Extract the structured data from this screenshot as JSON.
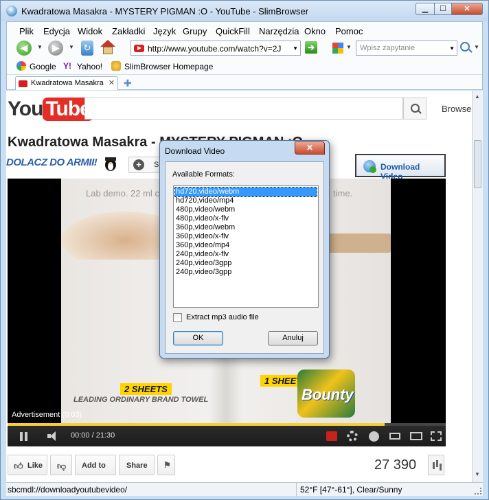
{
  "window": {
    "title": "Kwadratowa Masakra - MYSTERY PIGMAN :O - YouTube - SlimBrowser",
    "min": "▁",
    "max": "☐",
    "close": "✕"
  },
  "menu": [
    "Plik",
    "Edycja",
    "Widok",
    "Zakładki",
    "Język",
    "Grupy",
    "QuickFill",
    "Narzędzia",
    "Okno",
    "Pomoc"
  ],
  "nav": {
    "url": "http://www.youtube.com/watch?v=2J",
    "search_placeholder": "Wpisz zapytanie",
    "back_icon": "back-arrow-icon",
    "forward_icon": "forward-arrow-icon",
    "go_label": "➔"
  },
  "bookmarks": [
    {
      "label": "Google",
      "icon": "google-icon"
    },
    {
      "label": "Yahoo!",
      "icon": "yahoo-icon"
    },
    {
      "label": "SlimBrowser Homepage",
      "icon": "slimbrowser-icon"
    }
  ],
  "tabs": [
    {
      "label": "Kwadratowa Masakra",
      "close": "✕"
    }
  ],
  "page": {
    "logo_you": "You",
    "logo_tube": "Tube",
    "browse": "Browse",
    "video_title": "Kwadratowa Masakra - MYSTERY PIGMAN :O",
    "channel": "DOLACZ DO ARMII!",
    "subscribe_letter": "S",
    "download_button": "Download Video",
    "video_text_left": "Lab demo. 22 ml coff",
    "video_text_right": "time.",
    "sheets2": "2 SHEETS",
    "leading": "LEADING ORDINARY BRAND TOWEL",
    "sheet1": "1 SHEET",
    "bounty": "Bounty",
    "ad_label": "Advertisement (0:03)",
    "time": "00:00 / 21:30",
    "progress_fraction": 0.86,
    "actions": {
      "like": "Like",
      "add_to": "Add to",
      "share": "Share"
    },
    "views": "27 390"
  },
  "status": {
    "left": "sbcmdl://downloadyoutubevideo/",
    "right": "52°F [47°-61°], Clear/Sunny"
  },
  "dialog": {
    "title": "Download Video",
    "close": "✕",
    "formats_label": "Available Formats:",
    "formats": [
      "hd720,video/webm",
      "hd720,video/mp4",
      "480p,video/webm",
      "480p,video/x-flv",
      "360p,video/webm",
      "360p,video/x-flv",
      "360p,video/mp4",
      "240p,video/x-flv",
      "240p,video/3gpp",
      "240p,video/3gpp"
    ],
    "selected_index": 0,
    "mp3_label": "Extract mp3 audio file",
    "mp3_checked": false,
    "ok": "OK",
    "cancel": "Anuluj"
  },
  "colors": {
    "youtube_red": "#e52d27",
    "selection_blue": "#3399ff",
    "channel_blue": "#2b5da8"
  }
}
